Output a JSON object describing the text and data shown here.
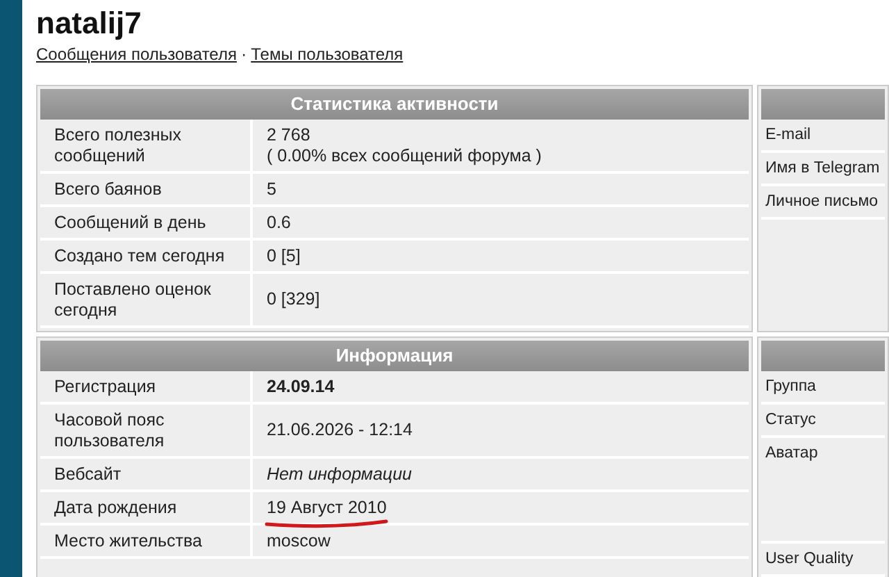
{
  "user": {
    "name": "natalij7"
  },
  "links": [
    {
      "label": "Сообщения пользователя"
    },
    {
      "label": "Темы пользователя"
    }
  ],
  "link_separator": "·",
  "sections": [
    {
      "title": "Статистика активности",
      "rows": [
        {
          "label": "Всего полезных сообщений",
          "value": "2 768",
          "note": "( 0.00% всех сообщений форума )",
          "kind": "plain"
        },
        {
          "label": "Всего баянов",
          "value": "5",
          "kind": "plain"
        },
        {
          "label": "Сообщений в день",
          "value": "0.6",
          "kind": "plain"
        },
        {
          "label": "Создано тем сегодня",
          "value": "0 [5]",
          "kind": "plain"
        },
        {
          "label": "Поставлено оценок сегодня",
          "value": "0 [329]",
          "kind": "plain"
        }
      ],
      "side_rows": [
        {
          "label": "E-mail",
          "kind": "text"
        },
        {
          "label": "Имя в Telegram",
          "kind": "text"
        },
        {
          "label": "Личное письмо",
          "kind": "text"
        }
      ]
    },
    {
      "title": "Информация",
      "rows": [
        {
          "label": "Регистрация",
          "value": "24.09.14",
          "kind": "bold"
        },
        {
          "label": "Часовой пояс пользователя",
          "value": "21.06.2026 - 12:14",
          "kind": "plain"
        },
        {
          "label": "Вебсайт",
          "value": "Нет информации",
          "kind": "italic"
        },
        {
          "label": "Дата рождения",
          "value": "19 Август 2010",
          "kind": "plain",
          "underlined": true
        },
        {
          "label": "Место жительства",
          "value": "moscow",
          "kind": "plain"
        }
      ],
      "side_rows": [
        {
          "label": "Группа",
          "kind": "text"
        },
        {
          "label": "Статус",
          "kind": "text"
        },
        {
          "label": "Аватар",
          "kind": "image"
        },
        {
          "label": "User Quality",
          "kind": "text"
        }
      ]
    }
  ]
}
